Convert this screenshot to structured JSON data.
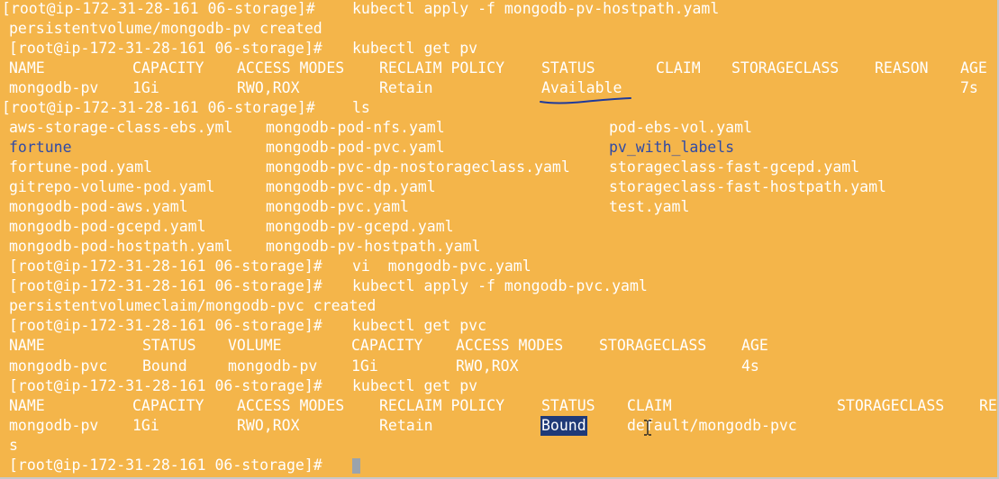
{
  "prompt": "[root@ip-172-31-28-161 06-storage]#",
  "lines": {
    "l0_cmd": "kubectl apply -f mongodb-pv-hostpath.yaml",
    "l1": "persistentvolume/mongodb-pv created",
    "l2_cmd": "kubectl get pv",
    "l9_cmd": "ls",
    "l13_cmd": "vi  mongodb-pvc.yaml",
    "l14_cmd": "kubectl apply -f mongodb-pvc.yaml",
    "l15": "persistentvolumeclaim/mongodb-pvc created",
    "l16_cmd": "kubectl get pvc",
    "l19_cmd": "kubectl get pv",
    "l22_trail": "s"
  },
  "pv_table_1": {
    "headers": [
      "NAME",
      "CAPACITY",
      "ACCESS MODES",
      "RECLAIM POLICY",
      "STATUS",
      "CLAIM",
      "STORAGECLASS",
      "REASON",
      "AGE"
    ],
    "row": {
      "name": "mongodb-pv",
      "capacity": "1Gi",
      "access": "RWO,ROX",
      "reclaim": "Retain",
      "status": "Available",
      "age": "7s"
    }
  },
  "ls_files": {
    "col1": [
      "aws-storage-class-ebs.yml",
      "fortune",
      "fortune-pod.yaml",
      "gitrepo-volume-pod.yaml",
      "mongodb-pod-aws.yaml",
      "mongodb-pod-gcepd.yaml",
      "mongodb-pod-hostpath.yaml"
    ],
    "col2": [
      "mongodb-pod-nfs.yaml",
      "mongodb-pod-pvc.yaml",
      "mongodb-pvc-dp-nostorageclass.yaml",
      "mongodb-pvc-dp.yaml",
      "mongodb-pvc.yaml",
      "mongodb-pv-gcepd.yaml",
      "mongodb-pv-hostpath.yaml"
    ],
    "col3": [
      "pod-ebs-vol.yaml",
      "pv_with_labels",
      "storageclass-fast-gcepd.yaml",
      "storageclass-fast-hostpath.yaml",
      "test.yaml"
    ]
  },
  "pvc_table": {
    "headers": [
      "NAME",
      "STATUS",
      "VOLUME",
      "CAPACITY",
      "ACCESS MODES",
      "STORAGECLASS",
      "AGE"
    ],
    "row": {
      "name": "mongodb-pvc",
      "status": "Bound",
      "volume": "mongodb-pv",
      "capacity": "1Gi",
      "access": "RWO,ROX",
      "age": "4s"
    }
  },
  "pv_table_2": {
    "headers": [
      "NAME",
      "CAPACITY",
      "ACCESS MODES",
      "RECLAIM POLICY",
      "STATUS",
      "CLAIM",
      "STORAGECLASS",
      "RE"
    ],
    "row": {
      "name": "mongodb-pv",
      "capacity": "1Gi",
      "access": "RWO,ROX",
      "reclaim": "Retain",
      "status": "Bound",
      "claim": "default/mongodb-pvc"
    }
  },
  "colors": {
    "background": "#f4b54a",
    "text": "#ffffff",
    "directory": "#2f4aa6",
    "selection": "#1f3a78",
    "annotation": "#1f3a9a"
  }
}
